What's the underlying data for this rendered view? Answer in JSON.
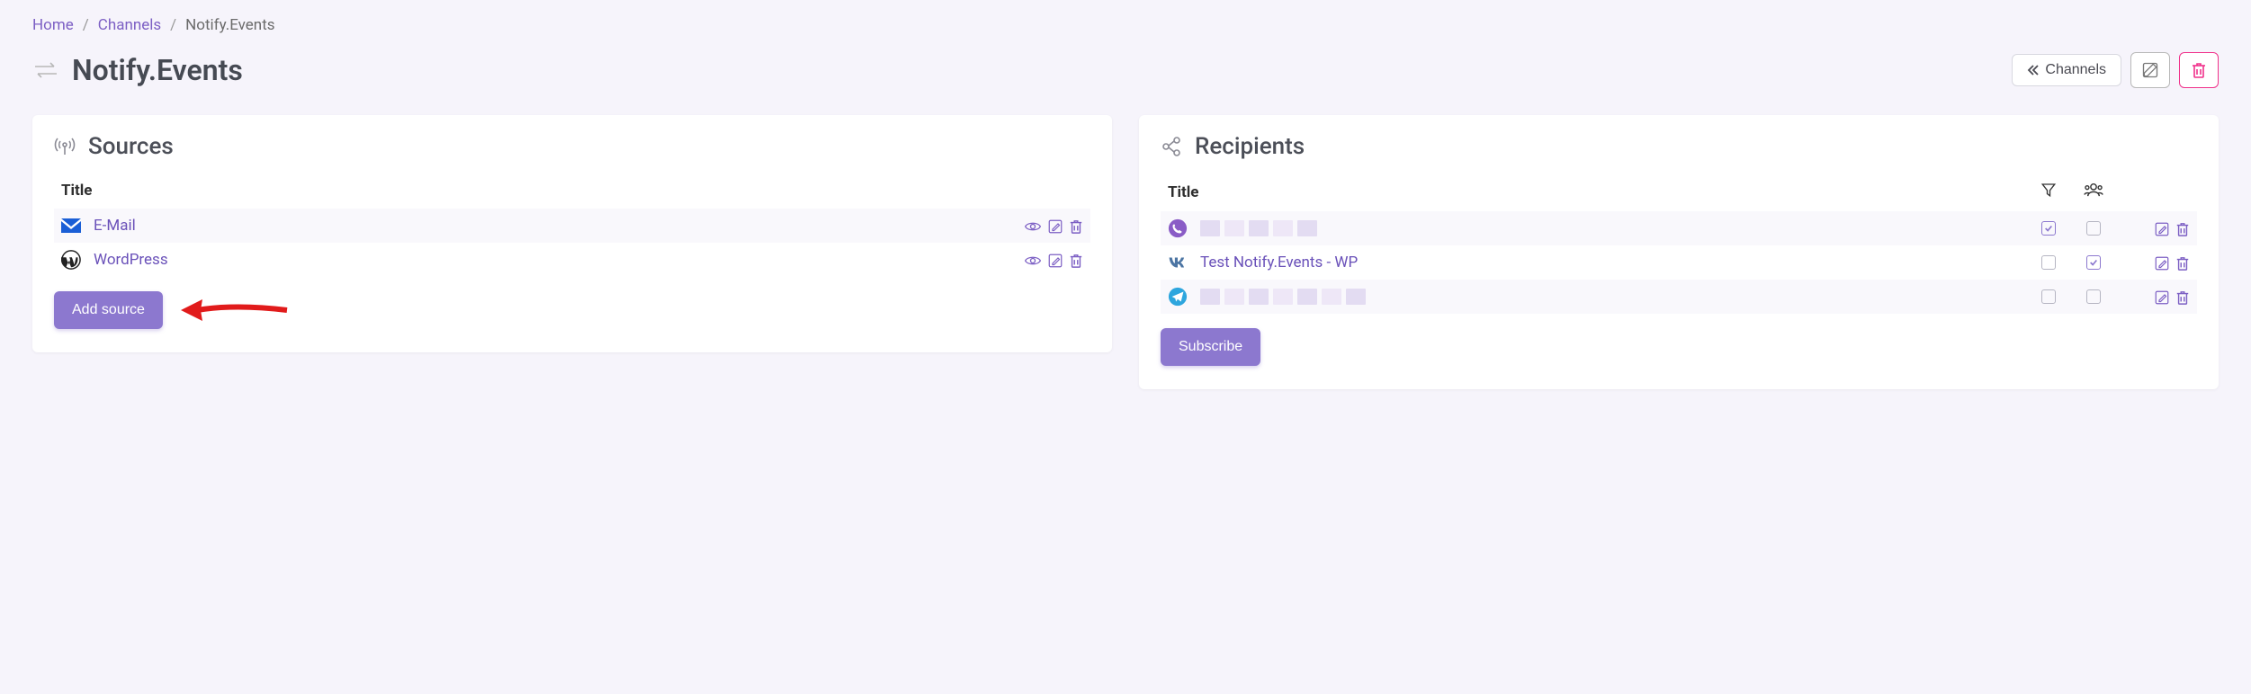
{
  "breadcrumb": {
    "home": "Home",
    "channels": "Channels",
    "current": "Notify.Events"
  },
  "header": {
    "title": "Notify.Events",
    "back_label": "Channels"
  },
  "sources": {
    "card_title": "Sources",
    "col_title": "Title",
    "rows": [
      {
        "icon": "email-icon",
        "label": "E-Mail"
      },
      {
        "icon": "wordpress-icon",
        "label": "WordPress"
      }
    ],
    "add_button": "Add source"
  },
  "recipients": {
    "card_title": "Recipients",
    "col_title": "Title",
    "rows": [
      {
        "icon": "viber-icon",
        "label": "",
        "blurred": true,
        "filter_checked": true,
        "group_checked": false
      },
      {
        "icon": "vk-icon",
        "label": "Test Notify.Events - WP",
        "blurred": false,
        "filter_checked": false,
        "group_checked": true
      },
      {
        "icon": "telegram-icon",
        "label": "",
        "blurred": true,
        "filter_checked": false,
        "group_checked": false
      }
    ],
    "subscribe_button": "Subscribe"
  }
}
